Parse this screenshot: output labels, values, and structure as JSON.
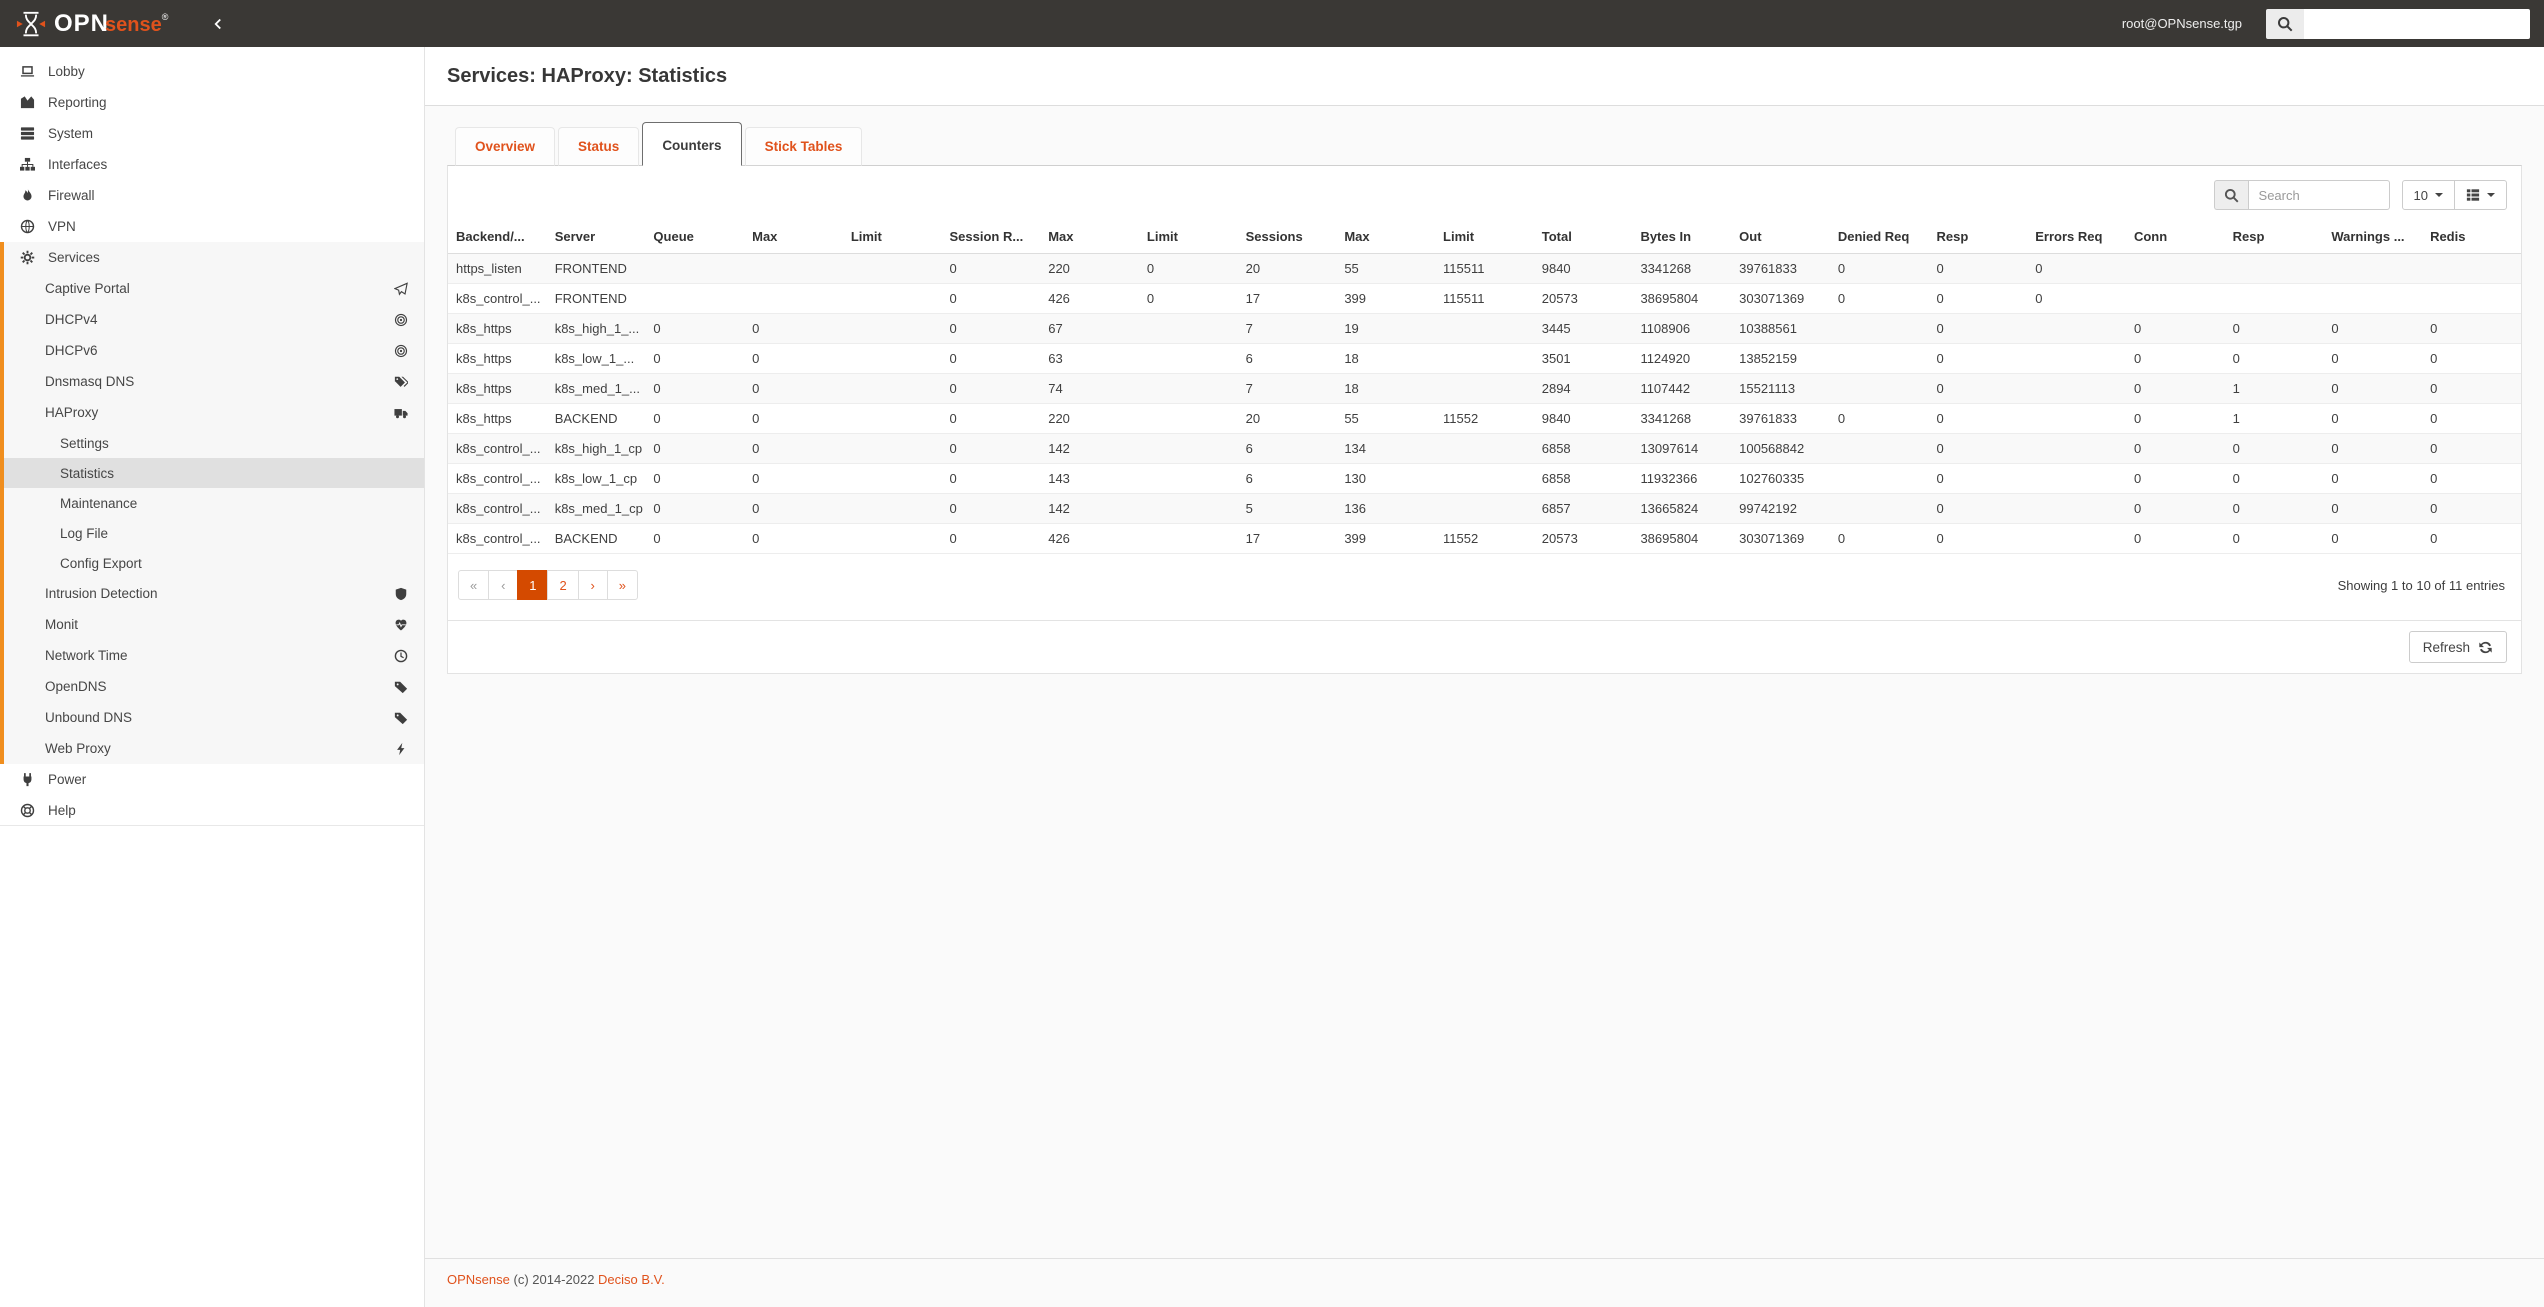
{
  "colors": {
    "accent_orange": "#e0521c",
    "pagination_active": "#d44a00",
    "sidebar_highlight_border": "#f08e1e",
    "header_bg": "#3a3835",
    "sidebar_active_item_bg": "#e0e0e0"
  },
  "header": {
    "logo_text_primary": "OPN",
    "logo_text_secondary": "sense",
    "registered_mark": "®",
    "username": "root@OPNsense.tgp",
    "search_value": ""
  },
  "sidebar": {
    "top_items": [
      {
        "label": "Lobby",
        "icon": "laptop"
      },
      {
        "label": "Reporting",
        "icon": "area-chart"
      },
      {
        "label": "System",
        "icon": "server"
      },
      {
        "label": "Interfaces",
        "icon": "sitemap"
      },
      {
        "label": "Firewall",
        "icon": "fire"
      },
      {
        "label": "VPN",
        "icon": "globe"
      }
    ],
    "services": {
      "label": "Services",
      "icon": "gear"
    },
    "service_items": [
      {
        "label": "Captive Portal",
        "icon": "paper-plane"
      },
      {
        "label": "DHCPv4",
        "icon": "bullseye"
      },
      {
        "label": "DHCPv6",
        "icon": "bullseye"
      },
      {
        "label": "Dnsmasq DNS",
        "icon": "tags"
      },
      {
        "label": "HAProxy",
        "icon": "truck"
      }
    ],
    "haproxy_items": [
      {
        "label": "Settings",
        "active": false
      },
      {
        "label": "Statistics",
        "active": true
      },
      {
        "label": "Maintenance",
        "active": false
      },
      {
        "label": "Log File",
        "active": false
      },
      {
        "label": "Config Export",
        "active": false
      }
    ],
    "service_items_after": [
      {
        "label": "Intrusion Detection",
        "icon": "shield"
      },
      {
        "label": "Monit",
        "icon": "heartbeat"
      },
      {
        "label": "Network Time",
        "icon": "clock"
      },
      {
        "label": "OpenDNS",
        "icon": "tag"
      },
      {
        "label": "Unbound DNS",
        "icon": "tag"
      },
      {
        "label": "Web Proxy",
        "icon": "bolt"
      }
    ],
    "bottom_items": [
      {
        "label": "Power",
        "icon": "plug"
      },
      {
        "label": "Help",
        "icon": "life-ring"
      }
    ]
  },
  "page": {
    "title": "Services: HAProxy: Statistics"
  },
  "tabs": [
    {
      "label": "Overview",
      "active": false
    },
    {
      "label": "Status",
      "active": false
    },
    {
      "label": "Counters",
      "active": true
    },
    {
      "label": "Stick Tables",
      "active": false
    }
  ],
  "toolbar": {
    "search_placeholder": "Search",
    "page_size": "10"
  },
  "table": {
    "columns": [
      "Backend/...",
      "Server",
      "Queue",
      "Max",
      "Limit",
      "Session R...",
      "Max",
      "Limit",
      "Sessions",
      "Max",
      "Limit",
      "Total",
      "Bytes In",
      "Out",
      "Denied Req",
      "Resp",
      "Errors Req",
      "Conn",
      "Resp",
      "Warnings ...",
      "Redis"
    ],
    "rows": [
      [
        "https_listen",
        "FRONTEND",
        "",
        "",
        "",
        "0",
        "220",
        "0",
        "20",
        "55",
        "115511",
        "9840",
        "3341268",
        "39761833",
        "0",
        "0",
        "0",
        "",
        "",
        "",
        ""
      ],
      [
        "k8s_control_...",
        "FRONTEND",
        "",
        "",
        "",
        "0",
        "426",
        "0",
        "17",
        "399",
        "115511",
        "20573",
        "38695804",
        "303071369",
        "0",
        "0",
        "0",
        "",
        "",
        "",
        ""
      ],
      [
        "k8s_https",
        "k8s_high_1_...",
        "0",
        "0",
        "",
        "0",
        "67",
        "",
        "7",
        "19",
        "",
        "3445",
        "1108906",
        "10388561",
        "",
        "0",
        "",
        "0",
        "0",
        "0",
        "0"
      ],
      [
        "k8s_https",
        "k8s_low_1_...",
        "0",
        "0",
        "",
        "0",
        "63",
        "",
        "6",
        "18",
        "",
        "3501",
        "1124920",
        "13852159",
        "",
        "0",
        "",
        "0",
        "0",
        "0",
        "0"
      ],
      [
        "k8s_https",
        "k8s_med_1_...",
        "0",
        "0",
        "",
        "0",
        "74",
        "",
        "7",
        "18",
        "",
        "2894",
        "1107442",
        "15521113",
        "",
        "0",
        "",
        "0",
        "1",
        "0",
        "0"
      ],
      [
        "k8s_https",
        "BACKEND",
        "0",
        "0",
        "",
        "0",
        "220",
        "",
        "20",
        "55",
        "11552",
        "9840",
        "3341268",
        "39761833",
        "0",
        "0",
        "",
        "0",
        "1",
        "0",
        "0"
      ],
      [
        "k8s_control_...",
        "k8s_high_1_cp",
        "0",
        "0",
        "",
        "0",
        "142",
        "",
        "6",
        "134",
        "",
        "6858",
        "13097614",
        "100568842",
        "",
        "0",
        "",
        "0",
        "0",
        "0",
        "0"
      ],
      [
        "k8s_control_...",
        "k8s_low_1_cp",
        "0",
        "0",
        "",
        "0",
        "143",
        "",
        "6",
        "130",
        "",
        "6858",
        "11932366",
        "102760335",
        "",
        "0",
        "",
        "0",
        "0",
        "0",
        "0"
      ],
      [
        "k8s_control_...",
        "k8s_med_1_cp",
        "0",
        "0",
        "",
        "0",
        "142",
        "",
        "5",
        "136",
        "",
        "6857",
        "13665824",
        "99742192",
        "",
        "0",
        "",
        "0",
        "0",
        "0",
        "0"
      ],
      [
        "k8s_control_...",
        "BACKEND",
        "0",
        "0",
        "",
        "0",
        "426",
        "",
        "17",
        "399",
        "11552",
        "20573",
        "38695804",
        "303071369",
        "0",
        "0",
        "",
        "0",
        "0",
        "0",
        "0"
      ]
    ]
  },
  "pagination": {
    "first": "«",
    "prev": "‹",
    "pages": [
      "1",
      "2"
    ],
    "active_page": "1",
    "next": "›",
    "last": "»"
  },
  "grid_status": "Showing 1 to 10 of 11 entries",
  "actions": {
    "refresh_label": "Refresh"
  },
  "footer": {
    "brand": "OPNsense",
    "copyright": " (c) 2014-2022 ",
    "company": "Deciso B.V."
  }
}
